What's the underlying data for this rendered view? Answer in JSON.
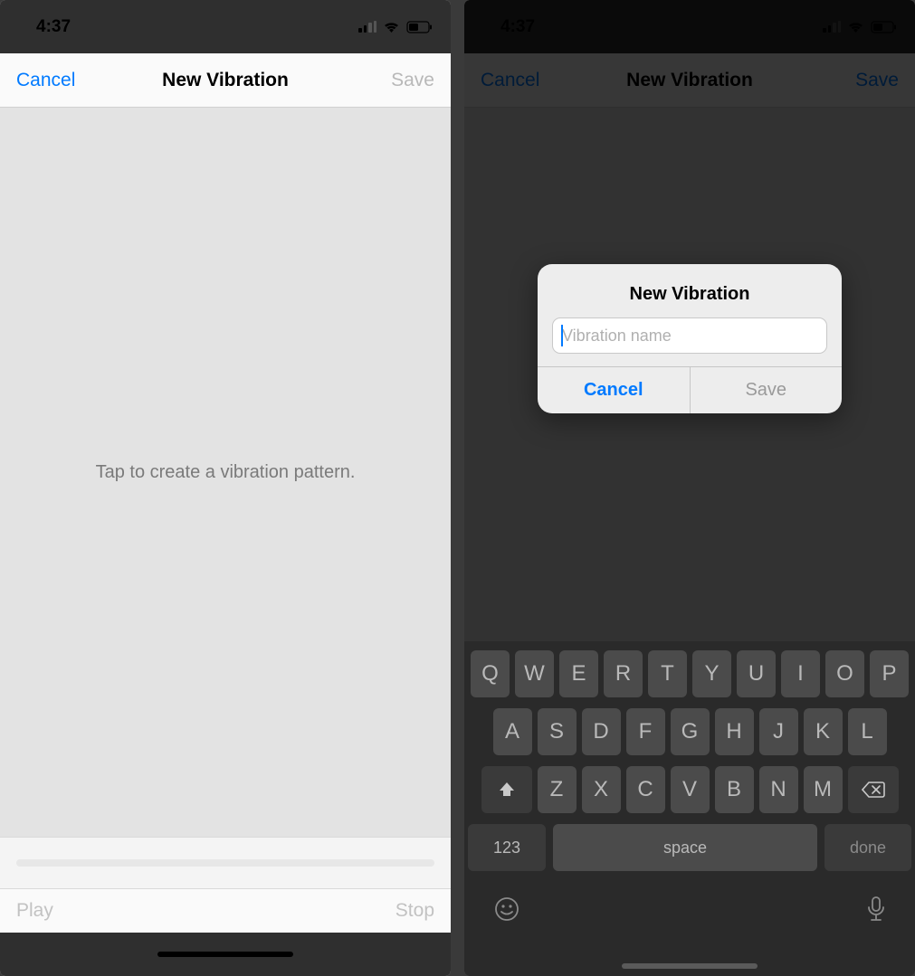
{
  "status": {
    "time": "4:37"
  },
  "left": {
    "nav": {
      "cancel": "Cancel",
      "title": "New Vibration",
      "save": "Save"
    },
    "hint": "Tap to create a vibration pattern.",
    "controls": {
      "play": "Play",
      "stop": "Stop"
    }
  },
  "right": {
    "nav": {
      "cancel": "Cancel",
      "title": "New Vibration",
      "save": "Save"
    },
    "dialog": {
      "title": "New Vibration",
      "placeholder": "Vibration name",
      "cancel": "Cancel",
      "save": "Save"
    },
    "keyboard": {
      "row1": [
        "Q",
        "W",
        "E",
        "R",
        "T",
        "Y",
        "U",
        "I",
        "O",
        "P"
      ],
      "row2": [
        "A",
        "S",
        "D",
        "F",
        "G",
        "H",
        "J",
        "K",
        "L"
      ],
      "row3": [
        "Z",
        "X",
        "C",
        "V",
        "B",
        "N",
        "M"
      ],
      "num": "123",
      "space": "space",
      "done": "done"
    }
  }
}
